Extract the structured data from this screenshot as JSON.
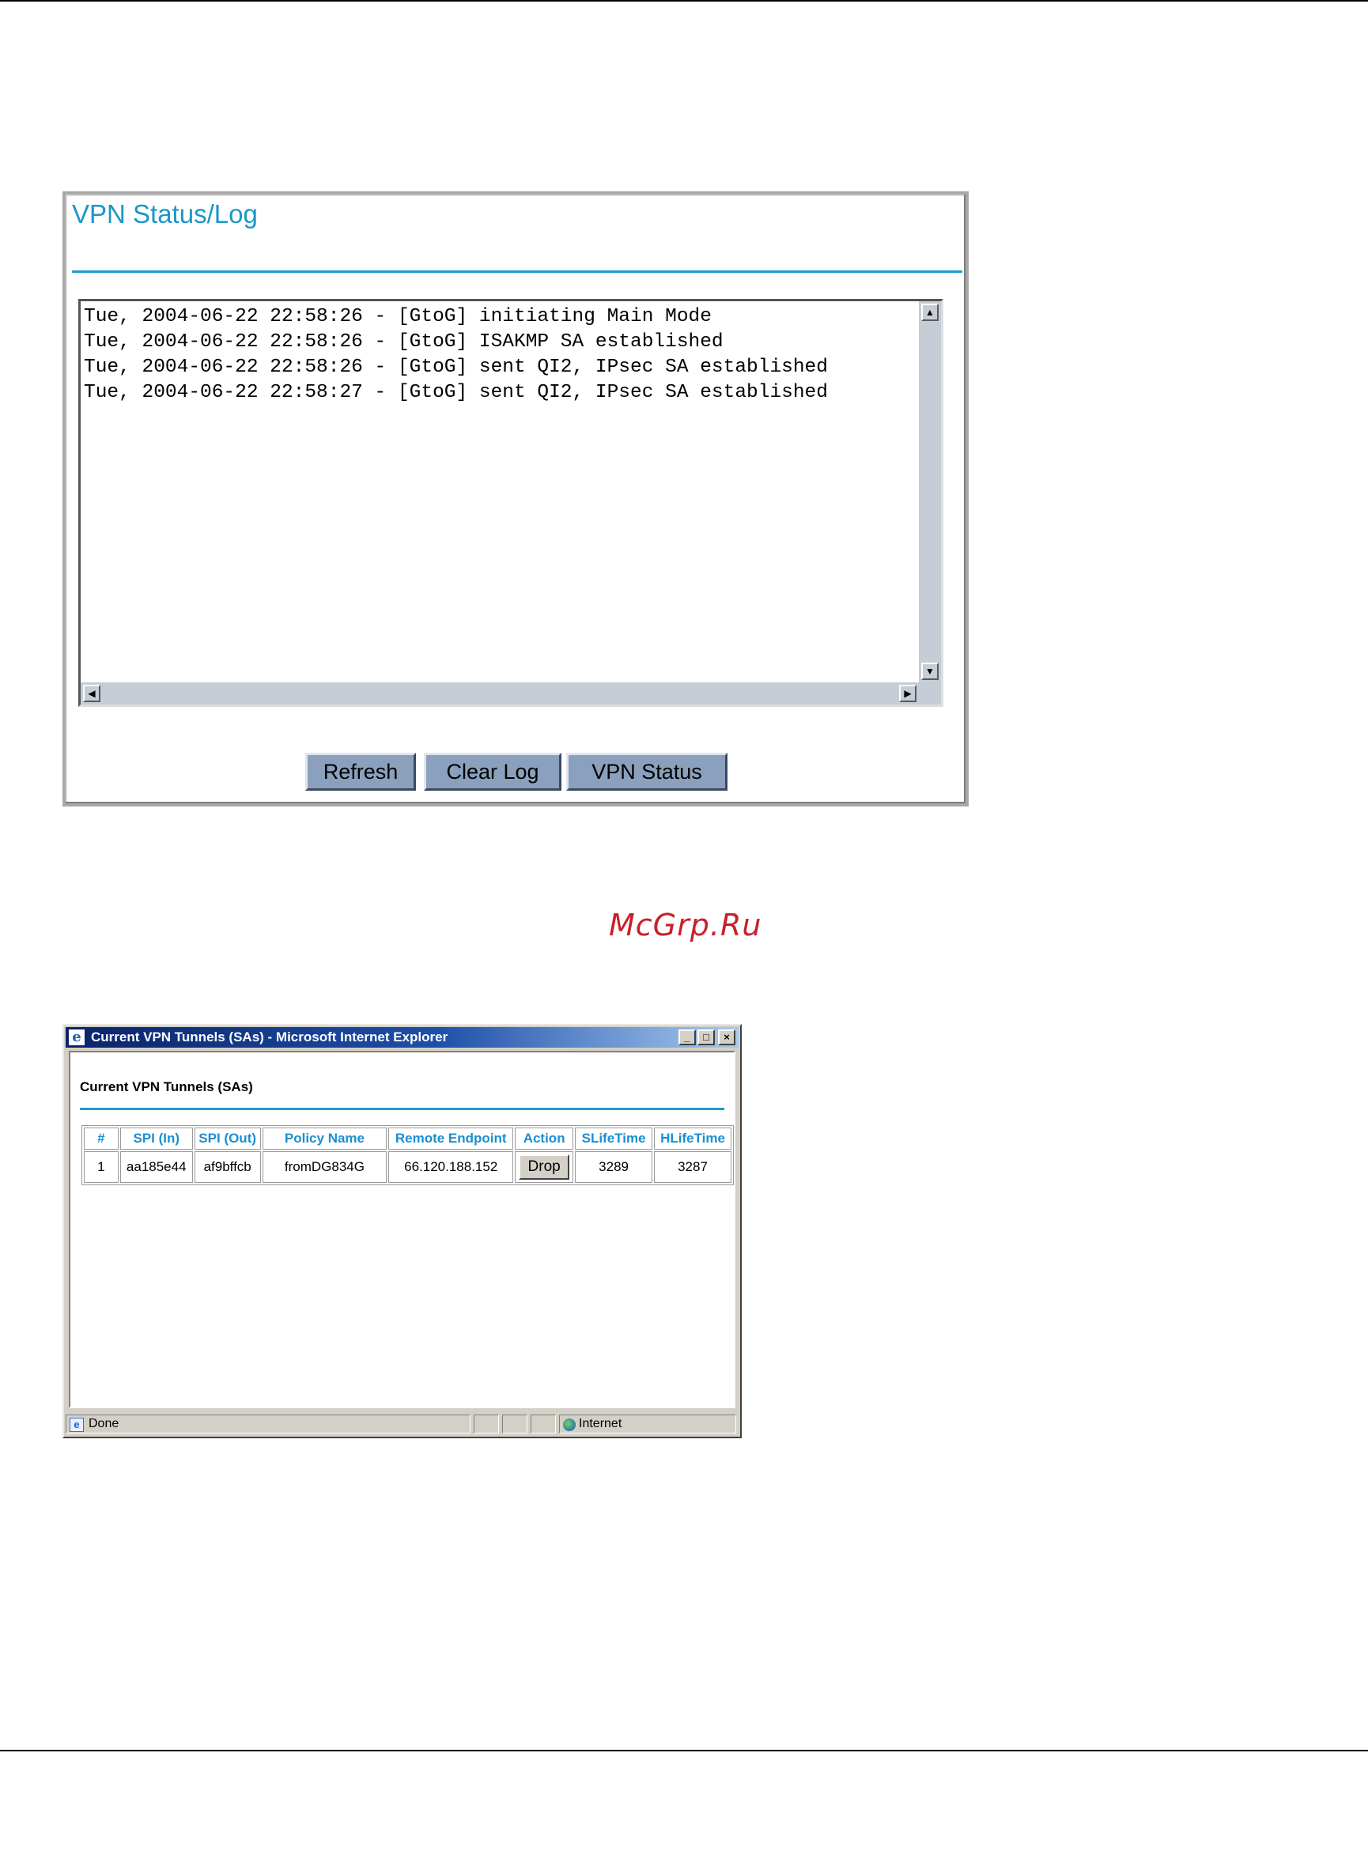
{
  "vpn_log": {
    "title": "VPN Status/Log",
    "log_lines": [
      "Tue, 2004-06-22 22:58:26 - [GtoG] initiating Main Mode",
      "Tue, 2004-06-22 22:58:26 - [GtoG] ISAKMP SA established",
      "Tue, 2004-06-22 22:58:26 - [GtoG] sent QI2, IPsec SA established",
      "Tue, 2004-06-22 22:58:27 - [GtoG] sent QI2, IPsec SA established"
    ],
    "buttons": {
      "refresh": "Refresh",
      "clear_log": "Clear Log",
      "vpn_status": "VPN Status"
    }
  },
  "watermark": "McGrp.Ru",
  "ie_window": {
    "title": "Current VPN Tunnels (SAs) - Microsoft Internet Explorer",
    "controls": {
      "minimize": "_",
      "maximize": "□",
      "close": "×"
    },
    "heading": "Current VPN Tunnels (SAs)",
    "table": {
      "headers": [
        "#",
        "SPI (In)",
        "SPI (Out)",
        "Policy Name",
        "Remote Endpoint",
        "Action",
        "SLifeTime",
        "HLifeTime"
      ],
      "rows": [
        {
          "num": "1",
          "spi_in": "aa185e44",
          "spi_out": "af9bffcb",
          "policy": "fromDG834G",
          "endpoint": "66.120.188.152",
          "action": "Drop",
          "slife": "3289",
          "hlife": "3287"
        }
      ]
    },
    "status": {
      "left": "Done",
      "zone": "Internet"
    }
  }
}
